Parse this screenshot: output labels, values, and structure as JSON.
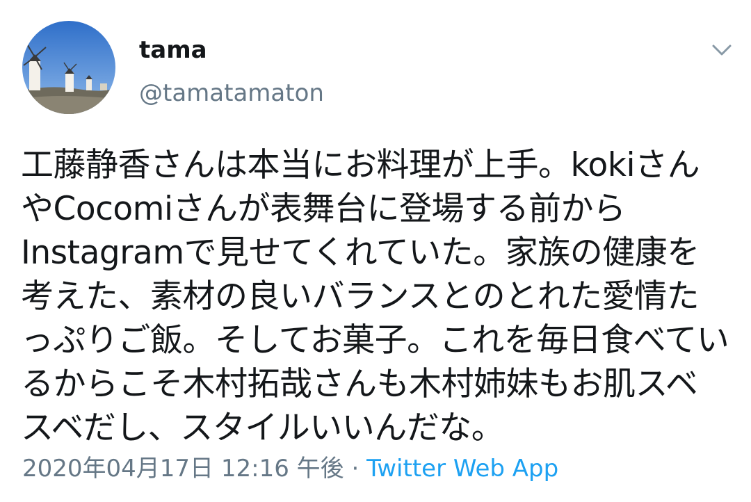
{
  "user": {
    "display_name": "tama",
    "handle": "@tamatamaton",
    "avatar_icon": "windmill-avatar"
  },
  "menu": {
    "caret_icon": "chevron-down-icon"
  },
  "tweet": {
    "text": "工藤静香さんは本当にお料理が上手。kokiさんやCocomiさんが表舞台に登場する前からInstagramで見せてくれていた。家族の健康を考えた、素材の良いバランスとのとれた愛情たっぷりご飯。そしてお菓子。これを毎日食べているからこそ木村拓哉さんも木村姉妹もお肌スベスベだし、スタイルいいんだな。",
    "timestamp": "2020年04月17日 12:16 午後",
    "separator": " · ",
    "source": "Twitter Web App"
  },
  "colors": {
    "text": "#14171a",
    "secondary": "#657786",
    "link": "#1da1f2"
  }
}
